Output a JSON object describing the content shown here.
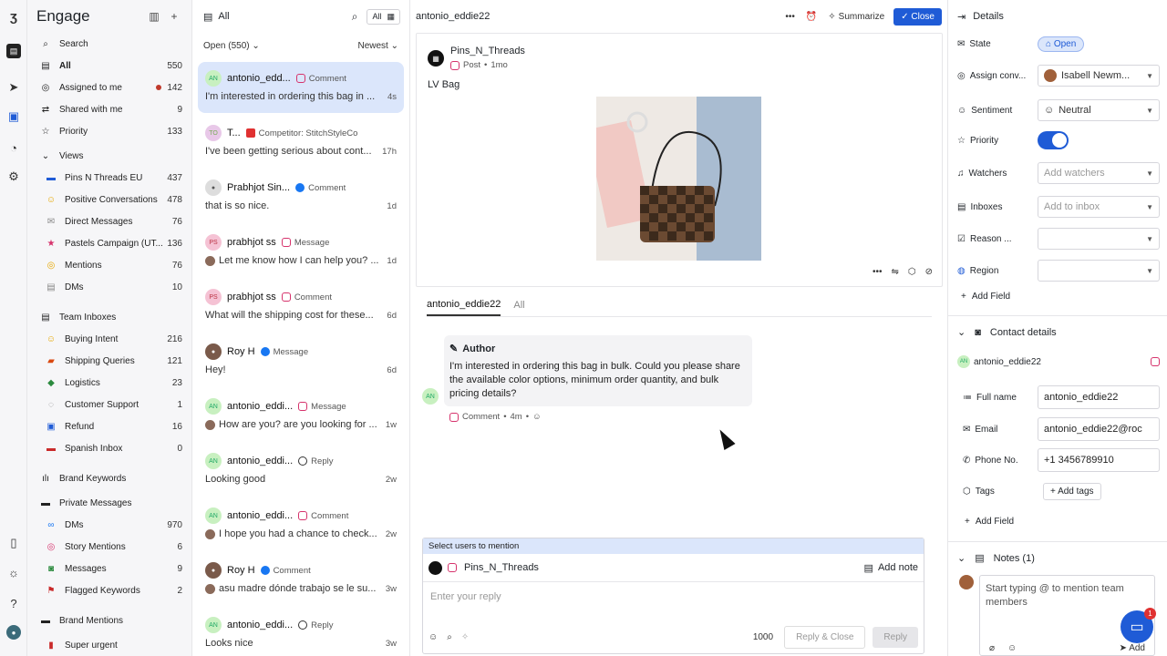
{
  "sidebar": {
    "title": "Engage",
    "search_label": "Search",
    "items": [
      {
        "label": "All",
        "count": "550"
      },
      {
        "label": "Assigned to me",
        "count": "142"
      },
      {
        "label": "Shared with me",
        "count": "9"
      },
      {
        "label": "Priority",
        "count": "133"
      }
    ],
    "views_label": "Views",
    "views": [
      {
        "label": "Pins N Threads EU",
        "count": "437"
      },
      {
        "label": "Positive Conversations",
        "count": "478"
      },
      {
        "label": "Direct Messages",
        "count": "76"
      },
      {
        "label": "Pastels Campaign (UT...",
        "count": "136"
      },
      {
        "label": "Mentions",
        "count": "76"
      },
      {
        "label": "DMs",
        "count": "10"
      }
    ],
    "team_inboxes_label": "Team Inboxes",
    "team_inboxes": [
      {
        "label": "Buying Intent",
        "count": "216"
      },
      {
        "label": "Shipping Queries",
        "count": "121"
      },
      {
        "label": "Logistics",
        "count": "23"
      },
      {
        "label": "Customer Support",
        "count": "1"
      },
      {
        "label": "Refund",
        "count": "16"
      },
      {
        "label": "Spanish Inbox",
        "count": "0"
      }
    ],
    "brand_keywords_label": "Brand Keywords",
    "private_messages_label": "Private Messages",
    "private_messages": [
      {
        "label": "DMs",
        "count": "970"
      },
      {
        "label": "Story Mentions",
        "count": "6"
      },
      {
        "label": "Messages",
        "count": "9"
      },
      {
        "label": "Flagged Keywords",
        "count": "2"
      }
    ],
    "brand_mentions_label": "Brand Mentions",
    "super_urgent_label": "Super urgent"
  },
  "list": {
    "title": "All",
    "filter_pill": "All",
    "status_filter": "Open (550)",
    "sort": "Newest",
    "conversations": [
      {
        "initials": "AN",
        "name": "antonio_edd...",
        "channel": "Comment",
        "text": "I'm interested in ordering this bag in ...",
        "time": "4s"
      },
      {
        "initials": "TO",
        "name": "T...",
        "channel": "Competitor: StitchStyleCo",
        "text": "I've been getting serious about cont...",
        "time": "17h"
      },
      {
        "initials": "",
        "name": "Prabhjot Sin...",
        "channel": "Comment",
        "text": "that is so nice.",
        "time": "1d"
      },
      {
        "initials": "PS",
        "name": "prabhjot ss",
        "channel": "Message",
        "text": "Let me know how I can help you? ...",
        "time": "1d"
      },
      {
        "initials": "PS",
        "name": "prabhjot ss",
        "channel": "Comment",
        "text": "What will the shipping cost for these...",
        "time": "6d"
      },
      {
        "initials": "",
        "name": "Roy H",
        "channel": "Message",
        "text": "Hey!",
        "time": "6d"
      },
      {
        "initials": "AN",
        "name": "antonio_eddi...",
        "channel": "Message",
        "text": "How are you? are you looking for ...",
        "time": "1w"
      },
      {
        "initials": "AN",
        "name": "antonio_eddi...",
        "channel": "Reply",
        "text": "Looking good",
        "time": "2w"
      },
      {
        "initials": "AN",
        "name": "antonio_eddi...",
        "channel": "Comment",
        "text": "I hope you had a chance to check...",
        "time": "2w"
      },
      {
        "initials": "",
        "name": "Roy H",
        "channel": "Comment",
        "text": "asu madre dónde trabajo se le su...",
        "time": "3w"
      },
      {
        "initials": "AN",
        "name": "antonio_eddi...",
        "channel": "Reply",
        "text": "Looks nice",
        "time": "3w"
      }
    ]
  },
  "main": {
    "title": "antonio_eddie22",
    "summarize_label": "Summarize",
    "close_label": "Close",
    "post": {
      "author": "Pins_N_Threads",
      "type": "Post",
      "age": "1mo",
      "caption": "LV Bag"
    },
    "tabs": [
      "antonio_eddie22",
      "All"
    ],
    "message": {
      "role": "Author",
      "text": "I'm interested in ordering this bag in bulk. Could you please share the available color options, minimum order quantity, and bulk pricing details?",
      "channel": "Comment",
      "age": "4m",
      "initials": "AN"
    },
    "composer": {
      "mention_bar": "Select users to mention",
      "account": "Pins_N_Threads",
      "add_note": "Add note",
      "placeholder": "Enter your reply",
      "char_count": "1000",
      "reply_close": "Reply & Close",
      "reply": "Reply"
    }
  },
  "details": {
    "title": "Details",
    "state_label": "State",
    "state_value": "Open",
    "assign_label": "Assign conv...",
    "assign_value": "Isabell Newm...",
    "sentiment_label": "Sentiment",
    "sentiment_value": "Neutral",
    "priority_label": "Priority",
    "watchers_label": "Watchers",
    "watchers_placeholder": "Add watchers",
    "inboxes_label": "Inboxes",
    "inboxes_placeholder": "Add to inbox",
    "reason_label": "Reason ...",
    "region_label": "Region",
    "add_field": "Add Field",
    "contact_title": "Contact details",
    "contact_handle": "antonio_eddie22",
    "fullname_label": "Full name",
    "fullname_value": "antonio_eddie22",
    "email_label": "Email",
    "email_value": "antonio_eddie22@roc",
    "phone_label": "Phone No.",
    "phone_value": "+1 3456789910",
    "tags_label": "Tags",
    "add_tags": "Add tags",
    "add_field2": "Add Field",
    "notes_title": "Notes (1)",
    "notes_placeholder": "Start typing @ to mention team members",
    "notes_add": "Add",
    "fab_badge": "1"
  }
}
